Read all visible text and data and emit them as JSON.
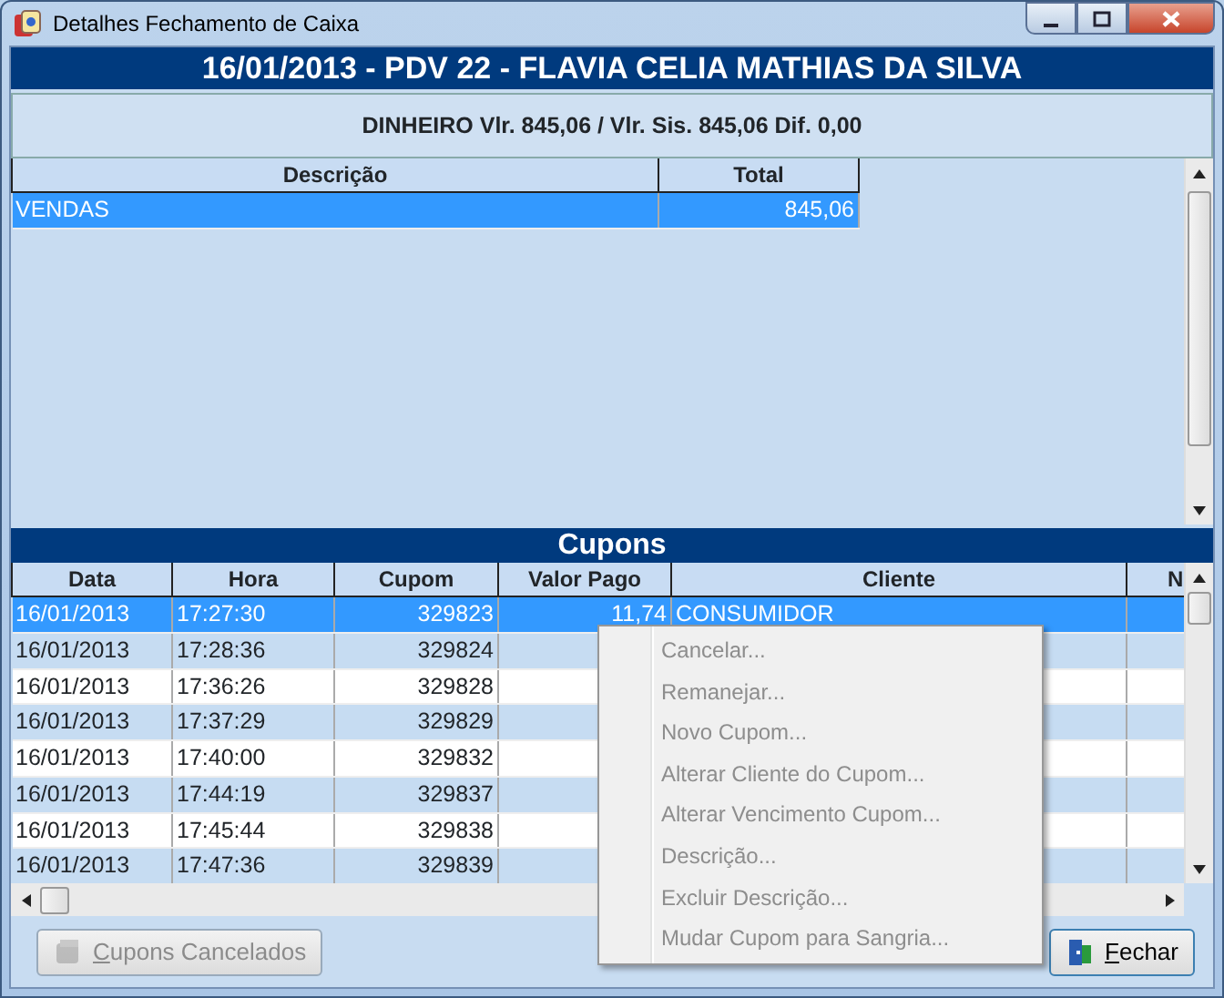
{
  "window": {
    "title": "Detalhes Fechamento de Caixa"
  },
  "header": "16/01/2013 - PDV 22 - FLAVIA CELIA MATHIAS DA SILVA",
  "summary": "DINHEIRO Vlr. 845,06 / Vlr. Sis. 845,06 Dif. 0,00",
  "totals_table": {
    "columns": [
      "Descrição",
      "Total"
    ],
    "rows": [
      {
        "descricao": "VENDAS",
        "total": "845,06",
        "selected": true
      }
    ]
  },
  "cupons": {
    "title": "Cupons",
    "columns": [
      "Data",
      "Hora",
      "Cupom",
      "Valor Pago",
      "Cliente",
      "N"
    ],
    "rows": [
      {
        "data": "16/01/2013",
        "hora": "17:27:30",
        "cupom": "329823",
        "valor_pago": "11,74",
        "cliente": "CONSUMIDOR",
        "selected": true
      },
      {
        "data": "16/01/2013",
        "hora": "17:28:36",
        "cupom": "329824",
        "selected": false
      },
      {
        "data": "16/01/2013",
        "hora": "17:36:26",
        "cupom": "329828",
        "selected": false
      },
      {
        "data": "16/01/2013",
        "hora": "17:37:29",
        "cupom": "329829",
        "selected": false
      },
      {
        "data": "16/01/2013",
        "hora": "17:40:00",
        "cupom": "329832",
        "selected": false
      },
      {
        "data": "16/01/2013",
        "hora": "17:44:19",
        "cupom": "329837",
        "selected": false
      },
      {
        "data": "16/01/2013",
        "hora": "17:45:44",
        "cupom": "329838",
        "selected": false
      },
      {
        "data": "16/01/2013",
        "hora": "17:47:36",
        "cupom": "329839",
        "selected": false
      }
    ]
  },
  "context_menu": [
    {
      "label": "Cancelar...",
      "disabled": true
    },
    {
      "label": "Remanejar...",
      "disabled": true
    },
    {
      "label": "Novo Cupom...",
      "disabled": true
    },
    {
      "label": "Alterar Cliente do Cupom...",
      "disabled": true
    },
    {
      "label": "Alterar Vencimento Cupom...",
      "disabled": true
    },
    {
      "label": "Descrição...",
      "disabled": true
    },
    {
      "label": "Excluir Descrição...",
      "disabled": true
    },
    {
      "label": "Mudar Cupom para Sangria...",
      "disabled": true
    }
  ],
  "buttons": [
    {
      "label": "Cupons Cancelados",
      "disabled": true
    },
    {
      "label": "Fechar",
      "disabled": false
    }
  ]
}
